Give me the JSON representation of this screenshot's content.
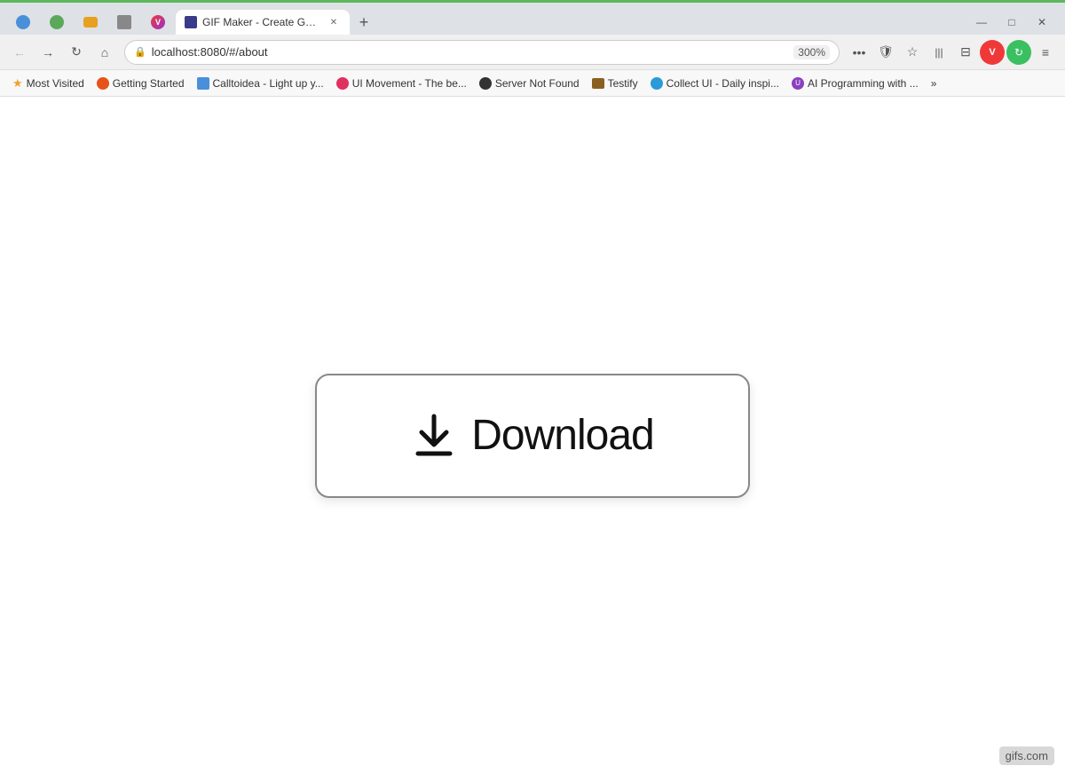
{
  "browser": {
    "top_accent_color": "#5cb85c",
    "tabs": [
      {
        "id": "tab-globe",
        "icon_type": "globe",
        "icon_color": "#4a90d9",
        "label": "",
        "active": false,
        "closeable": false
      },
      {
        "id": "tab-refresh",
        "icon_type": "refresh",
        "icon_color": "#5ba85a",
        "label": "",
        "active": false,
        "closeable": false
      },
      {
        "id": "tab-folder",
        "icon_type": "folder",
        "icon_color": "#d9a020",
        "label": "",
        "active": false,
        "closeable": false
      },
      {
        "id": "tab-noimg",
        "icon_type": "noimg",
        "icon_color": "#888",
        "label": "",
        "active": false,
        "closeable": false
      },
      {
        "id": "tab-vivaldi",
        "icon_type": "vivaldi",
        "icon_color": "#ef3939",
        "label": "",
        "active": false,
        "closeable": false
      },
      {
        "id": "tab-active",
        "icon_type": "gif",
        "icon_color": "#3a3a8a",
        "label": "GIF Maker - Create GIFs from V",
        "active": true,
        "closeable": true
      }
    ],
    "new_tab_label": "+",
    "window_controls": {
      "minimize": "—",
      "maximize": "□",
      "close": "✕"
    },
    "toolbar": {
      "back": "←",
      "forward": "→",
      "reload": "↻",
      "home": "⌂",
      "address": "localhost:8080/#/about",
      "zoom": "300%",
      "more": "•••",
      "shield": "🛡",
      "star": "☆",
      "reading_list": "|||",
      "split": "⊟",
      "vivaldi_icon": "V",
      "sync": "↻",
      "menu": "≡"
    },
    "bookmarks": [
      {
        "id": "bm-most-visited",
        "label": "Most Visited",
        "icon_color": "#f0a030",
        "icon_type": "star"
      },
      {
        "id": "bm-getting-started",
        "label": "Getting Started",
        "icon_color": "#e8521a",
        "icon_type": "fox"
      },
      {
        "id": "bm-calltoidea",
        "label": "Calltoidea - Light up y...",
        "icon_color": "#4a8fd9",
        "icon_type": "c"
      },
      {
        "id": "bm-ui-movement",
        "label": "UI Movement - The be...",
        "icon_color": "#e03060",
        "icon_type": "m"
      },
      {
        "id": "bm-server-not-found",
        "label": "Server Not Found",
        "icon_color": "#333",
        "icon_type": "github"
      },
      {
        "id": "bm-testify",
        "label": "Testify",
        "icon_color": "#8a6020",
        "icon_type": "folder"
      },
      {
        "id": "bm-collect-ui",
        "label": "Collect UI - Daily inspi...",
        "icon_color": "#2a9ad9",
        "icon_type": "collect"
      },
      {
        "id": "bm-ai-programming",
        "label": "AI Programming with ...",
        "icon_color": "#8a40c0",
        "icon_type": "ai"
      }
    ],
    "bookmarks_more": "»"
  },
  "page": {
    "download_button_label": "Download",
    "download_icon_title": "download-icon"
  },
  "watermark": {
    "text": "gifs.com"
  }
}
